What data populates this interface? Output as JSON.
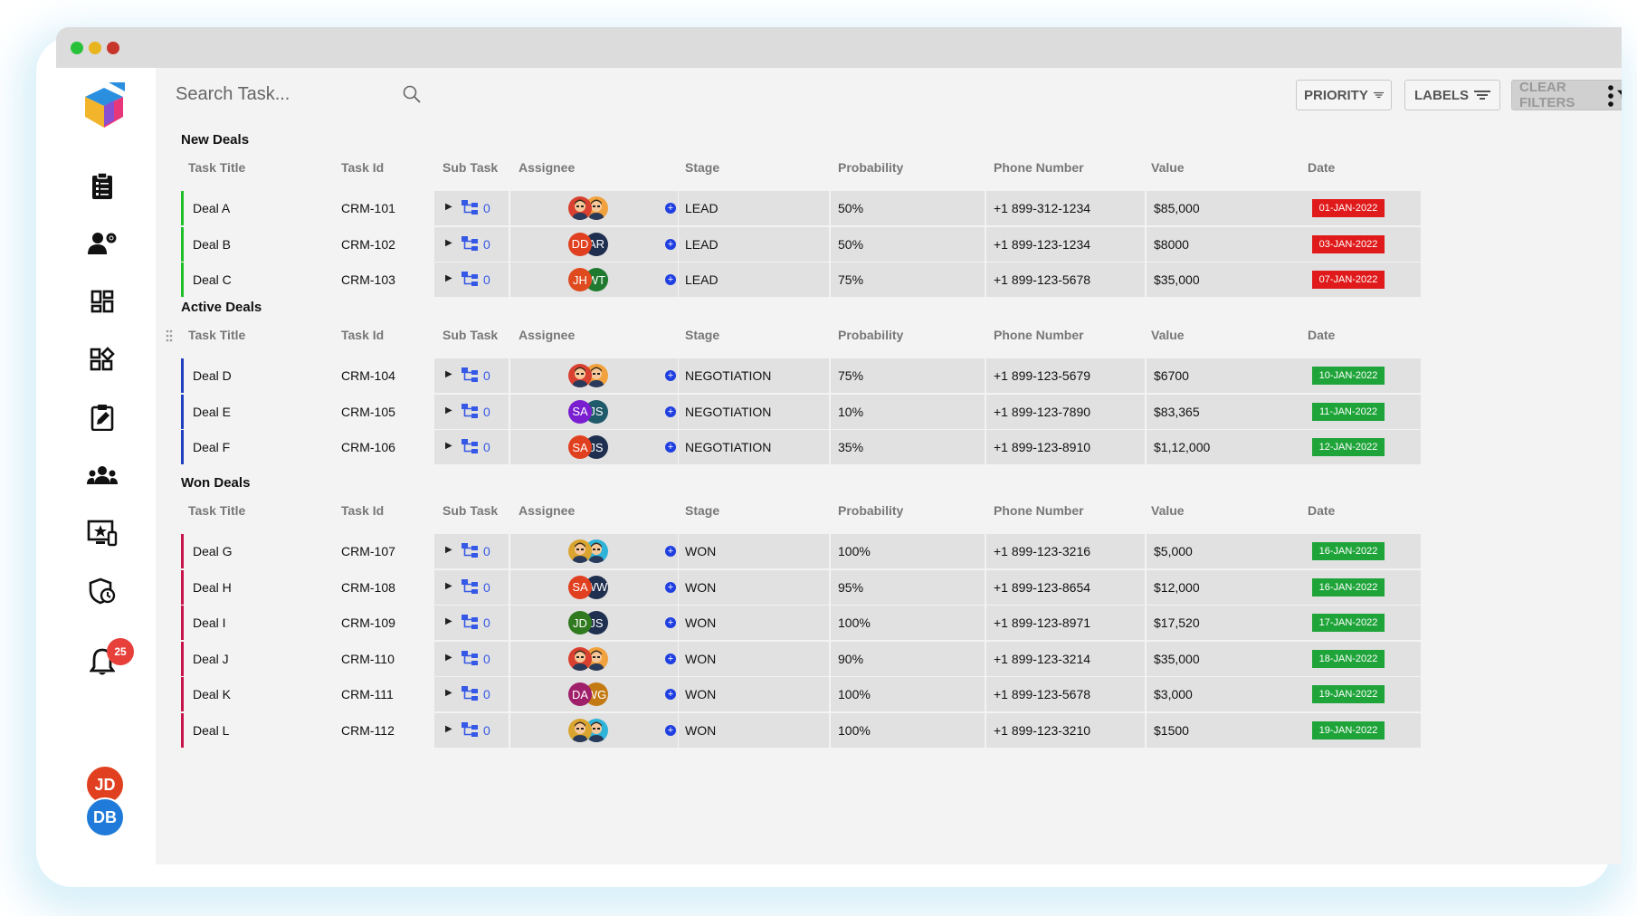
{
  "search": {
    "placeholder": "Search Task..."
  },
  "toolbar": {
    "priority_label": "PRIORITY",
    "labels_label": "LABELS",
    "clear_filters_label": "CLEAR FILTERS"
  },
  "sidebar": {
    "items": [
      {
        "icon": "clipboard-list-icon"
      },
      {
        "icon": "user-settings-icon"
      },
      {
        "icon": "dashboard-icon"
      },
      {
        "icon": "widgets-add-icon"
      },
      {
        "icon": "edit-task-icon"
      },
      {
        "icon": "team-icon"
      },
      {
        "icon": "monitor-star-icon"
      },
      {
        "icon": "shield-time-icon"
      },
      {
        "icon": "bell-icon"
      }
    ],
    "notification_count": "25",
    "users": [
      "JD",
      "DB"
    ]
  },
  "columns": [
    "Task Title",
    "Task Id",
    "Sub Task",
    "Assignee",
    "Stage",
    "Probability",
    "Phone Number",
    "Value",
    "Date"
  ],
  "colors": {
    "new": "#1fbf2a",
    "active": "#1f3fbf",
    "won": "#c8124a",
    "date_red": "#e01a1a",
    "date_green": "#1fa43a"
  },
  "groups": [
    {
      "title": "New Deals",
      "color": "#1fbf2a",
      "date_color": "#e01a1a",
      "rows": [
        {
          "title": "Deal A",
          "id": "CRM-101",
          "sub": "0",
          "assignees": [
            [
              "face",
              "#d9402f"
            ],
            [
              "face",
              "#f1a13d"
            ]
          ],
          "stage": "LEAD",
          "probability": "50%",
          "phone": "+1 899-312-1234",
          "value": "$85,000",
          "date": "01-JAN-2022"
        },
        {
          "title": "Deal B",
          "id": "CRM-102",
          "sub": "0",
          "assignees": [
            [
              "DD",
              "#e0401f"
            ],
            [
              "AR",
              "#1f2f4f"
            ]
          ],
          "stage": "LEAD",
          "probability": "50%",
          "phone": "+1 899-123-1234",
          "value": "$8000",
          "date": "03-JAN-2022"
        },
        {
          "title": "Deal C",
          "id": "CRM-103",
          "sub": "0",
          "assignees": [
            [
              "JH",
              "#e04a1f"
            ],
            [
              "WT",
              "#1f7a2f"
            ]
          ],
          "stage": "LEAD",
          "probability": "75%",
          "phone": "+1 899-123-5678",
          "value": "$35,000",
          "date": "07-JAN-2022"
        }
      ]
    },
    {
      "title": "Active Deals",
      "color": "#1f3fbf",
      "date_color": "#1fa43a",
      "rows": [
        {
          "title": "Deal D",
          "id": "CRM-104",
          "sub": "0",
          "assignees": [
            [
              "face",
              "#d9402f"
            ],
            [
              "face",
              "#f1a13d"
            ]
          ],
          "stage": "NEGOTIATION",
          "probability": "75%",
          "phone": "+1 899-123-5679",
          "value": "$6700",
          "date": "10-JAN-2022"
        },
        {
          "title": "Deal E",
          "id": "CRM-105",
          "sub": "0",
          "assignees": [
            [
              "SA",
              "#7a1fd0"
            ],
            [
              "JS",
              "#1f5a6a"
            ]
          ],
          "stage": "NEGOTIATION",
          "probability": "10%",
          "phone": "+1 899-123-7890",
          "value": "$83,365",
          "date": "11-JAN-2022"
        },
        {
          "title": "Deal F",
          "id": "CRM-106",
          "sub": "0",
          "assignees": [
            [
              "SA",
              "#e0401f"
            ],
            [
              "JS",
              "#1f2f4f"
            ]
          ],
          "stage": "NEGOTIATION",
          "probability": "35%",
          "phone": "+1 899-123-8910",
          "value": "$1,12,000",
          "date": "12-JAN-2022"
        }
      ]
    },
    {
      "title": "Won Deals",
      "color": "#c8124a",
      "date_color": "#1fa43a",
      "rows": [
        {
          "title": "Deal G",
          "id": "CRM-107",
          "sub": "0",
          "assignees": [
            [
              "face",
              "#d9a52f"
            ],
            [
              "face",
              "#2fb4d9"
            ]
          ],
          "stage": "WON",
          "probability": "100%",
          "phone": "+1 899-123-3216",
          "value": "$5,000",
          "date": "16-JAN-2022"
        },
        {
          "title": "Deal H",
          "id": "CRM-108",
          "sub": "0",
          "assignees": [
            [
              "SA",
              "#e0401f"
            ],
            [
              "WW",
              "#1f2f4f"
            ]
          ],
          "stage": "WON",
          "probability": "95%",
          "phone": "+1 899-123-8654",
          "value": "$12,000",
          "date": "16-JAN-2022"
        },
        {
          "title": "Deal I",
          "id": "CRM-109",
          "sub": "0",
          "assignees": [
            [
              "JD",
              "#2f7a1f"
            ],
            [
              "JS",
              "#1f2f4f"
            ]
          ],
          "stage": "WON",
          "probability": "100%",
          "phone": "+1 899-123-8971",
          "value": "$17,520",
          "date": "17-JAN-2022"
        },
        {
          "title": "Deal J",
          "id": "CRM-110",
          "sub": "0",
          "assignees": [
            [
              "face",
              "#d9402f"
            ],
            [
              "face",
              "#f1a13d"
            ]
          ],
          "stage": "WON",
          "probability": "90%",
          "phone": "+1 899-123-3214",
          "value": "$35,000",
          "date": "18-JAN-2022"
        },
        {
          "title": "Deal K",
          "id": "CRM-111",
          "sub": "0",
          "assignees": [
            [
              "DA",
              "#a01f6a"
            ],
            [
              "WG",
              "#c47a12"
            ]
          ],
          "stage": "WON",
          "probability": "100%",
          "phone": "+1 899-123-5678",
          "value": "$3,000",
          "date": "19-JAN-2022"
        },
        {
          "title": "Deal L",
          "id": "CRM-112",
          "sub": "0",
          "assignees": [
            [
              "face",
              "#d9a52f"
            ],
            [
              "face",
              "#2fb4d9"
            ]
          ],
          "stage": "WON",
          "probability": "100%",
          "phone": "+1 899-123-3210",
          "value": "$1500",
          "date": "19-JAN-2022"
        }
      ]
    }
  ]
}
